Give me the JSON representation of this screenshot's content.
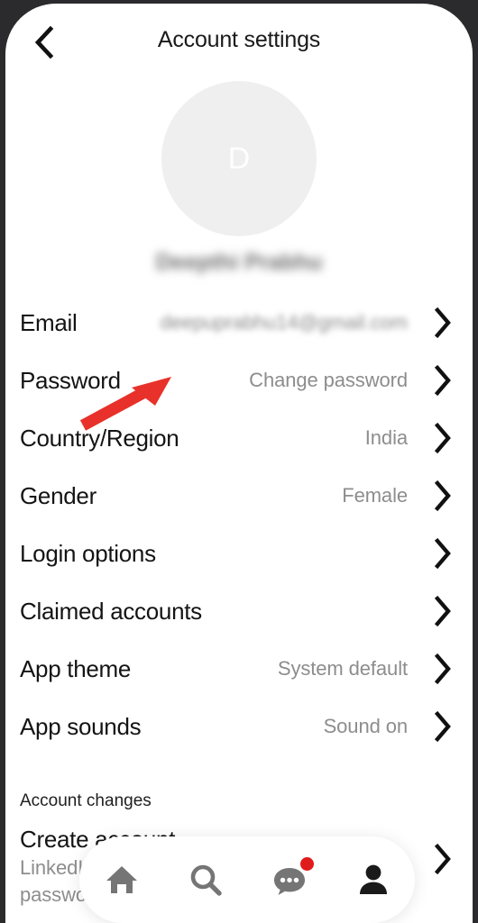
{
  "header": {
    "title": "Account settings",
    "back_icon": "chevron-left-icon"
  },
  "profile": {
    "avatar_initial": "D",
    "name": "Deepthi Prabhu",
    "name_blurred": true
  },
  "settings": {
    "rows": [
      {
        "label": "Email",
        "value": "deepuprabhu14@gmail.com",
        "blurred": true,
        "name": "email"
      },
      {
        "label": "Password",
        "value": "Change password",
        "blurred": false,
        "name": "password"
      },
      {
        "label": "Country/Region",
        "value": "India",
        "blurred": false,
        "name": "country-region"
      },
      {
        "label": "Gender",
        "value": "Female",
        "blurred": false,
        "name": "gender"
      },
      {
        "label": "Login options",
        "value": "",
        "blurred": false,
        "name": "login-options"
      },
      {
        "label": "Claimed accounts",
        "value": "",
        "blurred": false,
        "name": "claimed-accounts"
      },
      {
        "label": "App theme",
        "value": "System default",
        "blurred": false,
        "name": "app-theme"
      },
      {
        "label": "App sounds",
        "value": "Sound on",
        "blurred": false,
        "name": "app-sounds"
      }
    ],
    "chevron_icon": "chevron-right-icon"
  },
  "account_changes": {
    "section_header": "Account changes",
    "create_title": "Create account",
    "create_subtitle": "LinkedIn uses your email address and password as your"
  },
  "annotation": {
    "arrow_color": "#E8312A",
    "points_at": "Password"
  },
  "bottom_nav": {
    "items": [
      {
        "name": "home",
        "icon": "home-icon",
        "active": false
      },
      {
        "name": "search",
        "icon": "search-icon",
        "active": false
      },
      {
        "name": "messages",
        "icon": "chat-bubble-icon",
        "active": false,
        "badge": true
      },
      {
        "name": "profile",
        "icon": "person-icon",
        "active": true
      }
    ]
  },
  "colors": {
    "accent_red": "#E8312A",
    "badge_red": "#E01B1B",
    "text_primary": "#141414",
    "text_secondary": "#8D8D8D",
    "avatar_bg": "#EFEFEF",
    "nav_inactive": "#757575",
    "nav_active": "#1A1A1A",
    "bezel": "#2B2B2D"
  }
}
